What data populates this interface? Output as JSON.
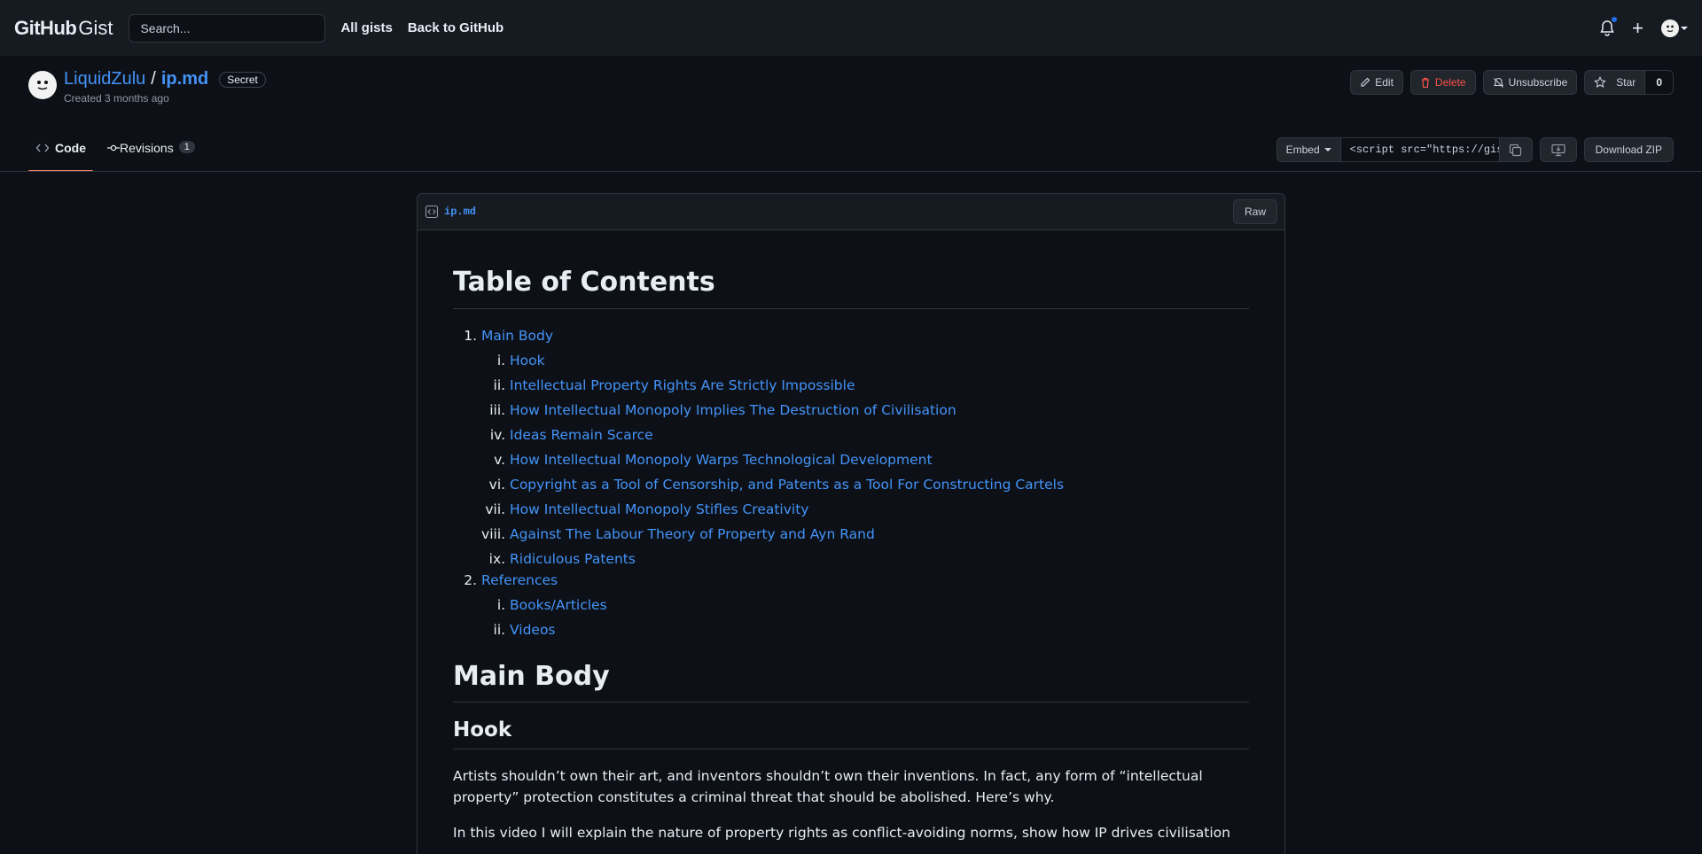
{
  "header": {
    "logo_bold": "GitHub",
    "logo_light": "Gist",
    "search_placeholder": "Search...",
    "nav": [
      "All gists",
      "Back to GitHub"
    ]
  },
  "gist": {
    "owner": "LiquidZulu",
    "separator": "/",
    "filename": "ip.md",
    "visibility": "Secret",
    "created": "Created 3 months ago"
  },
  "actions": {
    "edit": "Edit",
    "delete": "Delete",
    "unsubscribe": "Unsubscribe",
    "star": "Star",
    "star_count": "0"
  },
  "tabs": {
    "code": "Code",
    "revisions": "Revisions",
    "revisions_count": "1"
  },
  "embed": {
    "label": "Embed",
    "value": "<script src=\"https://gist.github.com/LiquidZulu/",
    "download": "Download ZIP"
  },
  "file": {
    "name": "ip.md",
    "raw": "Raw"
  },
  "markdown": {
    "toc_title": "Table of Contents",
    "toc": [
      {
        "label": "Main Body",
        "children": [
          "Hook",
          "Intellectual Property Rights Are Strictly Impossible",
          "How Intellectual Monopoly Implies The Destruction of Civilisation",
          "Ideas Remain Scarce",
          "How Intellectual Monopoly Warps Technological Development",
          "Copyright as a Tool of Censorship, and Patents as a Tool For Constructing Cartels",
          "How Intellectual Monopoly Stifles Creativity",
          "Against The Labour Theory of Property and Ayn Rand",
          "Ridiculous Patents"
        ]
      },
      {
        "label": "References",
        "children": [
          "Books/Articles",
          "Videos"
        ]
      }
    ],
    "main_title": "Main Body",
    "hook_title": "Hook",
    "paragraphs": [
      "Artists shouldn’t own their art, and inventors shouldn’t own their inventions. In fact, any form of “intellectual property” protection constitutes a criminal threat that should be abolished. Here’s why.",
      "In this video I will explain the nature of property rights as conflict-avoiding norms, show how IP drives civilisation"
    ]
  },
  "colors": {
    "background": "#0d1117",
    "header": "#161b22",
    "link": "#4493f8",
    "danger": "#f85149",
    "tab_underline": "#f78166"
  }
}
